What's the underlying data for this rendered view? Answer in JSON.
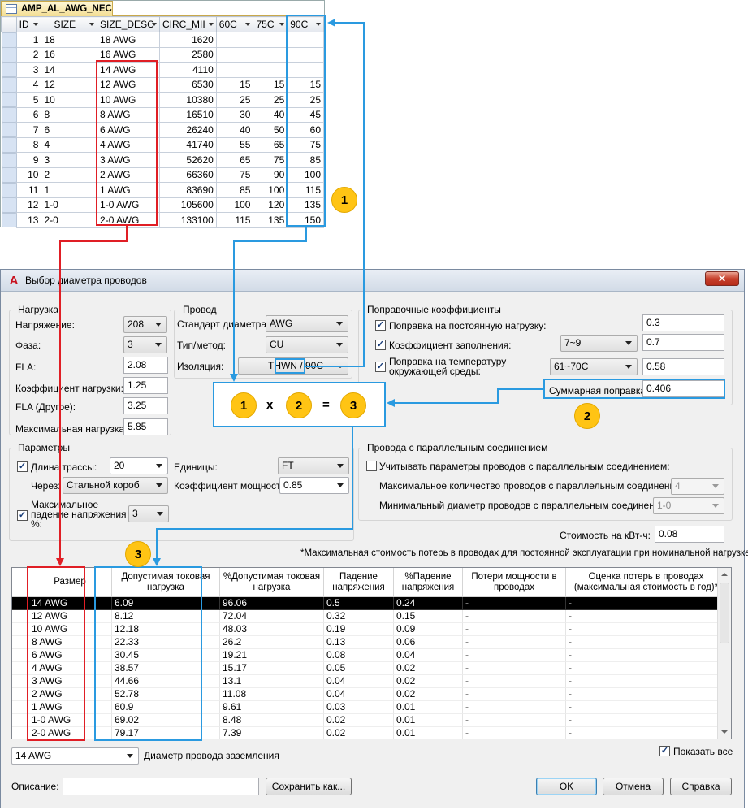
{
  "access": {
    "tab_title": "AMP_AL_AWG_NEC",
    "columns": [
      "ID",
      "SIZE",
      "SIZE_DESC",
      "CIRC_MII",
      "60C",
      "75C",
      "90C"
    ],
    "rows": [
      [
        "1",
        "18",
        "18 AWG",
        "1620",
        "",
        "",
        ""
      ],
      [
        "2",
        "16",
        "16 AWG",
        "2580",
        "",
        "",
        ""
      ],
      [
        "3",
        "14",
        "14 AWG",
        "4110",
        "",
        "",
        ""
      ],
      [
        "4",
        "12",
        "12 AWG",
        "6530",
        "15",
        "15",
        "15"
      ],
      [
        "5",
        "10",
        "10 AWG",
        "10380",
        "25",
        "25",
        "25"
      ],
      [
        "6",
        "8",
        "8 AWG",
        "16510",
        "30",
        "40",
        "45"
      ],
      [
        "7",
        "6",
        "6 AWG",
        "26240",
        "40",
        "50",
        "60"
      ],
      [
        "8",
        "4",
        "4 AWG",
        "41740",
        "55",
        "65",
        "75"
      ],
      [
        "9",
        "3",
        "3 AWG",
        "52620",
        "65",
        "75",
        "85"
      ],
      [
        "10",
        "2",
        "2 AWG",
        "66360",
        "75",
        "90",
        "100"
      ],
      [
        "11",
        "1",
        "1 AWG",
        "83690",
        "85",
        "100",
        "115"
      ],
      [
        "12",
        "1-0",
        "1-0 AWG",
        "105600",
        "100",
        "120",
        "135"
      ],
      [
        "13",
        "2-0",
        "2-0 AWG",
        "133100",
        "115",
        "135",
        "150"
      ]
    ]
  },
  "dialog": {
    "title": "Выбор диаметра проводов",
    "close": "✕",
    "load": {
      "group": "Нагрузка",
      "voltage_label": "Напряжение:",
      "voltage": "208",
      "phase_label": "Фаза:",
      "phase": "3",
      "fla_label": "FLA:",
      "fla": "2.08",
      "load_factor_label": "Коэффициент нагрузки:",
      "load_factor": "1.25",
      "fla_other_label": "FLA (Другое):",
      "fla_other": "3.25",
      "max_load_label": "Максимальная нагрузка:",
      "max_load": "5.85"
    },
    "wire": {
      "group": "Провод",
      "standard_label": "Стандарт диаметра:",
      "standard": "AWG",
      "type_label": "Тип/метод:",
      "type": "CU",
      "insulation_label": "Изоляция:",
      "insulation": "THWN / 90C"
    },
    "corr": {
      "group": "Поправочные коэффициенты",
      "constant_label": "Поправка на постоянную нагрузку:",
      "constant": "0.3",
      "fill_label": "Коэффициент заполнения:",
      "fill_range": "7~9",
      "fill": "0.7",
      "temp_label_1": "Поправка на температуру",
      "temp_label_2": "окружающей среды:",
      "temp_range": "61~70C",
      "temp": "0.58",
      "total_label": "Суммарная поправка:",
      "total": "0.406"
    },
    "params": {
      "group": "Параметры",
      "length_label": "Длина трассы:",
      "length": "20",
      "units_label": "Единицы:",
      "units": "FT",
      "via_label": "Через:",
      "via": "Стальной короб",
      "pf_label": "Коэффициент мощности:",
      "pf": "0.85",
      "vdrop_label_1": "Максимальное",
      "vdrop_label_2": "падение напряжения",
      "vdrop_label_3": "%:",
      "vdrop": "3"
    },
    "parallel": {
      "group": "Провода с параллельным соединением",
      "consider_label": "Учитывать параметры проводов с параллельным соединением:",
      "max_count_label": "Максимальное количество проводов с параллельным соединением:",
      "max_count": "4",
      "min_diam_label": "Минимальный диаметр проводов с параллельным соединением:",
      "min_diam": "1-0"
    },
    "cost_label": "Стоимость на кВт-ч:",
    "cost": "0.08",
    "footnote": "*Максимальная стоимость потерь в проводах для постоянной эксплуатации при номинальной нагрузке",
    "grid": {
      "headers": [
        [
          "Размер"
        ],
        [
          "Допустимая токовая",
          "нагрузка"
        ],
        [
          "%Допустимая токовая",
          "нагрузка"
        ],
        [
          "Падение",
          "напряжения"
        ],
        [
          "%Падение",
          "напряжения"
        ],
        [
          "Потери мощности в",
          "проводах"
        ],
        [
          "Оценка потерь в проводах",
          "(максимальная стоимость в год)*"
        ]
      ],
      "rows": [
        [
          "14 AWG",
          "6.09",
          "96.06",
          "0.5",
          "0.24",
          "-",
          "-"
        ],
        [
          "12 AWG",
          "8.12",
          "72.04",
          "0.32",
          "0.15",
          "-",
          "-"
        ],
        [
          "10 AWG",
          "12.18",
          "48.03",
          "0.19",
          "0.09",
          "-",
          "-"
        ],
        [
          "8 AWG",
          "22.33",
          "26.2",
          "0.13",
          "0.06",
          "-",
          "-"
        ],
        [
          "6 AWG",
          "30.45",
          "19.21",
          "0.08",
          "0.04",
          "-",
          "-"
        ],
        [
          "4 AWG",
          "38.57",
          "15.17",
          "0.05",
          "0.02",
          "-",
          "-"
        ],
        [
          "3 AWG",
          "44.66",
          "13.1",
          "0.04",
          "0.02",
          "-",
          "-"
        ],
        [
          "2 AWG",
          "52.78",
          "11.08",
          "0.04",
          "0.02",
          "-",
          "-"
        ],
        [
          "1 AWG",
          "60.9",
          "9.61",
          "0.03",
          "0.01",
          "-",
          "-"
        ],
        [
          "1-0 AWG",
          "69.02",
          "8.48",
          "0.02",
          "0.01",
          "-",
          "-"
        ],
        [
          "2-0 AWG",
          "79.17",
          "7.39",
          "0.02",
          "0.01",
          "-",
          "-"
        ]
      ]
    },
    "show_all": "Показать все",
    "ground_value": "14 AWG",
    "ground_label": "Диаметр провода заземления",
    "desc_label": "Описание:",
    "save_as": "Сохранить как...",
    "ok": "OK",
    "cancel": "Отмена",
    "help": "Справка"
  },
  "annotations": {
    "b1": "1",
    "b2": "2",
    "b3": "3",
    "op_x": "x",
    "op_eq": "="
  },
  "colors": {
    "red": "#e01e25",
    "blue": "#2a9ae0",
    "badge": "#ffc414"
  }
}
